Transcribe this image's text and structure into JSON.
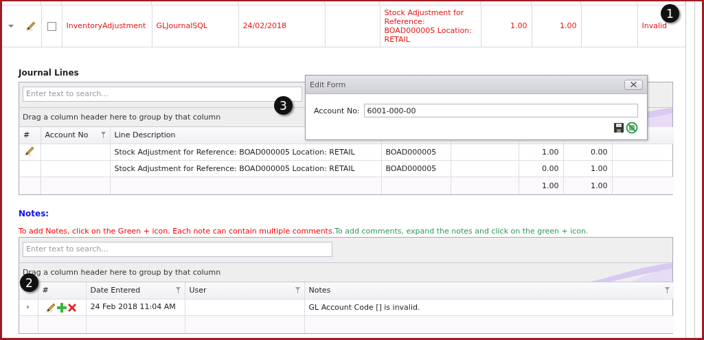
{
  "master_row": {
    "expanded": true,
    "checked": false,
    "column_3": "InventoryAdjustment",
    "column_4": "GLJournalSQL",
    "column_5": "24/02/2018",
    "column_7": "Stock Adjustment for Reference: BOAD000005 Location: RETAIL",
    "column_8": "1.00",
    "column_9": "1.00",
    "column_11": "Invalid"
  },
  "journal_lines": {
    "title": "Journal Lines",
    "search": {
      "placeholder": "Enter text to search..."
    },
    "group_hint": "Drag a column header here to group by that column",
    "columns": [
      {
        "label": "#",
        "filter": false
      },
      {
        "label": "Account No",
        "filter": true
      },
      {
        "label": "Line Description"
      }
    ],
    "rows": [
      {
        "editing": true,
        "description": "Stock Adjustment for Reference: BOAD000005 Location: RETAIL",
        "column_4": "BOAD000005",
        "column_6": "1.00",
        "column_7": "0.00"
      },
      {
        "editing": false,
        "description": "Stock Adjustment for Reference: BOAD000005 Location: RETAIL",
        "column_4": "BOAD000005",
        "column_6": "0.00",
        "column_7": "1.00"
      }
    ],
    "totals": {
      "column_6": "1.00",
      "column_7": "1.00"
    }
  },
  "notes": {
    "title": "Notes:",
    "instructions": [
      {
        "text": "To add Notes, click on the Green + icon. Each note can contain multiple comments.",
        "color": "#ff0000"
      },
      {
        "text": "To add comments, expand the notes and click on the green + icon.",
        "color": "#2e9a5a"
      }
    ],
    "search": {
      "placeholder": "Enter text to search..."
    },
    "group_hint": "Drag a column header here to group by that column",
    "columns": [
      {
        "label": "#",
        "filter": false
      },
      {
        "label": "Date Entered",
        "filter": true
      },
      {
        "label": "User",
        "filter": true
      },
      {
        "label": "Notes",
        "filter": true
      }
    ],
    "rows": [
      {
        "expanded": false,
        "date": "24 Feb 2018 11:04 AM",
        "notes": "GL Account Code [] is invalid."
      }
    ]
  },
  "dialog": {
    "title": "Edit Form",
    "field": {
      "label": "Account No:",
      "value": "6001-000-00"
    }
  },
  "callouts": [
    {
      "number": "1"
    },
    {
      "number": "2"
    },
    {
      "number": "3"
    }
  ]
}
